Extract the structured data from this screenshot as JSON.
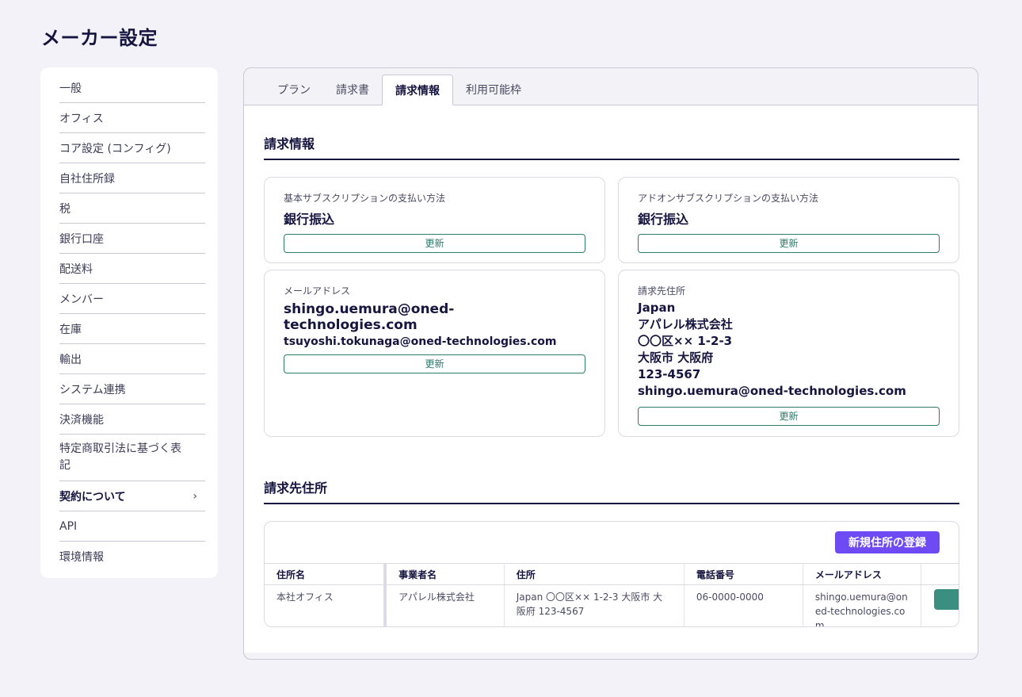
{
  "page_title": "メーカー設定",
  "sidebar": {
    "items": [
      {
        "label": "一般"
      },
      {
        "label": "オフィス"
      },
      {
        "label": "コア設定 (コンフィグ)"
      },
      {
        "label": "自社住所録"
      },
      {
        "label": "税"
      },
      {
        "label": "銀行口座"
      },
      {
        "label": "配送料"
      },
      {
        "label": "メンバー"
      },
      {
        "label": "在庫"
      },
      {
        "label": "輸出"
      },
      {
        "label": "システム連携"
      },
      {
        "label": "決済機能"
      },
      {
        "label": "特定商取引法に基づく表記"
      },
      {
        "label": "契約について"
      },
      {
        "label": "API"
      },
      {
        "label": "環境情報"
      }
    ],
    "active": "契約について"
  },
  "tabs": [
    {
      "label": "プラン"
    },
    {
      "label": "請求書"
    },
    {
      "label": "請求情報"
    },
    {
      "label": "利用可能枠"
    }
  ],
  "active_tab": "請求情報",
  "billing_info": {
    "section_title": "請求情報",
    "base_payment": {
      "label": "基本サブスクリプションの支払い方法",
      "value": "銀行振込"
    },
    "addon_payment": {
      "label": "アドオンサブスクリプションの支払い方法",
      "value": "銀行振込"
    },
    "email": {
      "label": "メールアドレス",
      "primary": "shingo.uemura@oned-technologies.com",
      "secondary": "tsuyoshi.tokunaga@oned-technologies.com"
    },
    "billing_address": {
      "label": "請求先住所",
      "lines": [
        "Japan",
        "アパレル株式会社",
        "〇〇区×× 1-2-3",
        "大阪市 大阪府",
        "123-4567",
        "shingo.uemura@oned-technologies.com"
      ]
    },
    "update_label": "更新"
  },
  "address_section": {
    "title": "請求先住所",
    "new_button": "新規住所の登録",
    "columns": [
      "住所名",
      "事業者名",
      "住所",
      "電話番号",
      "メールアドレス"
    ],
    "rows": [
      {
        "name": "本社オフィス",
        "business": "アパレル株式会社",
        "address": "Japan 〇〇区×× 1-2-3 大阪市 大阪府 123-4567",
        "phone": "06-0000-0000",
        "email": "shingo.uemura@oned-technologies.com"
      }
    ]
  },
  "colors": {
    "accent_purple": "#6e4af5",
    "accent_green": "#2e7a6b",
    "background": "#f2f2f8"
  }
}
